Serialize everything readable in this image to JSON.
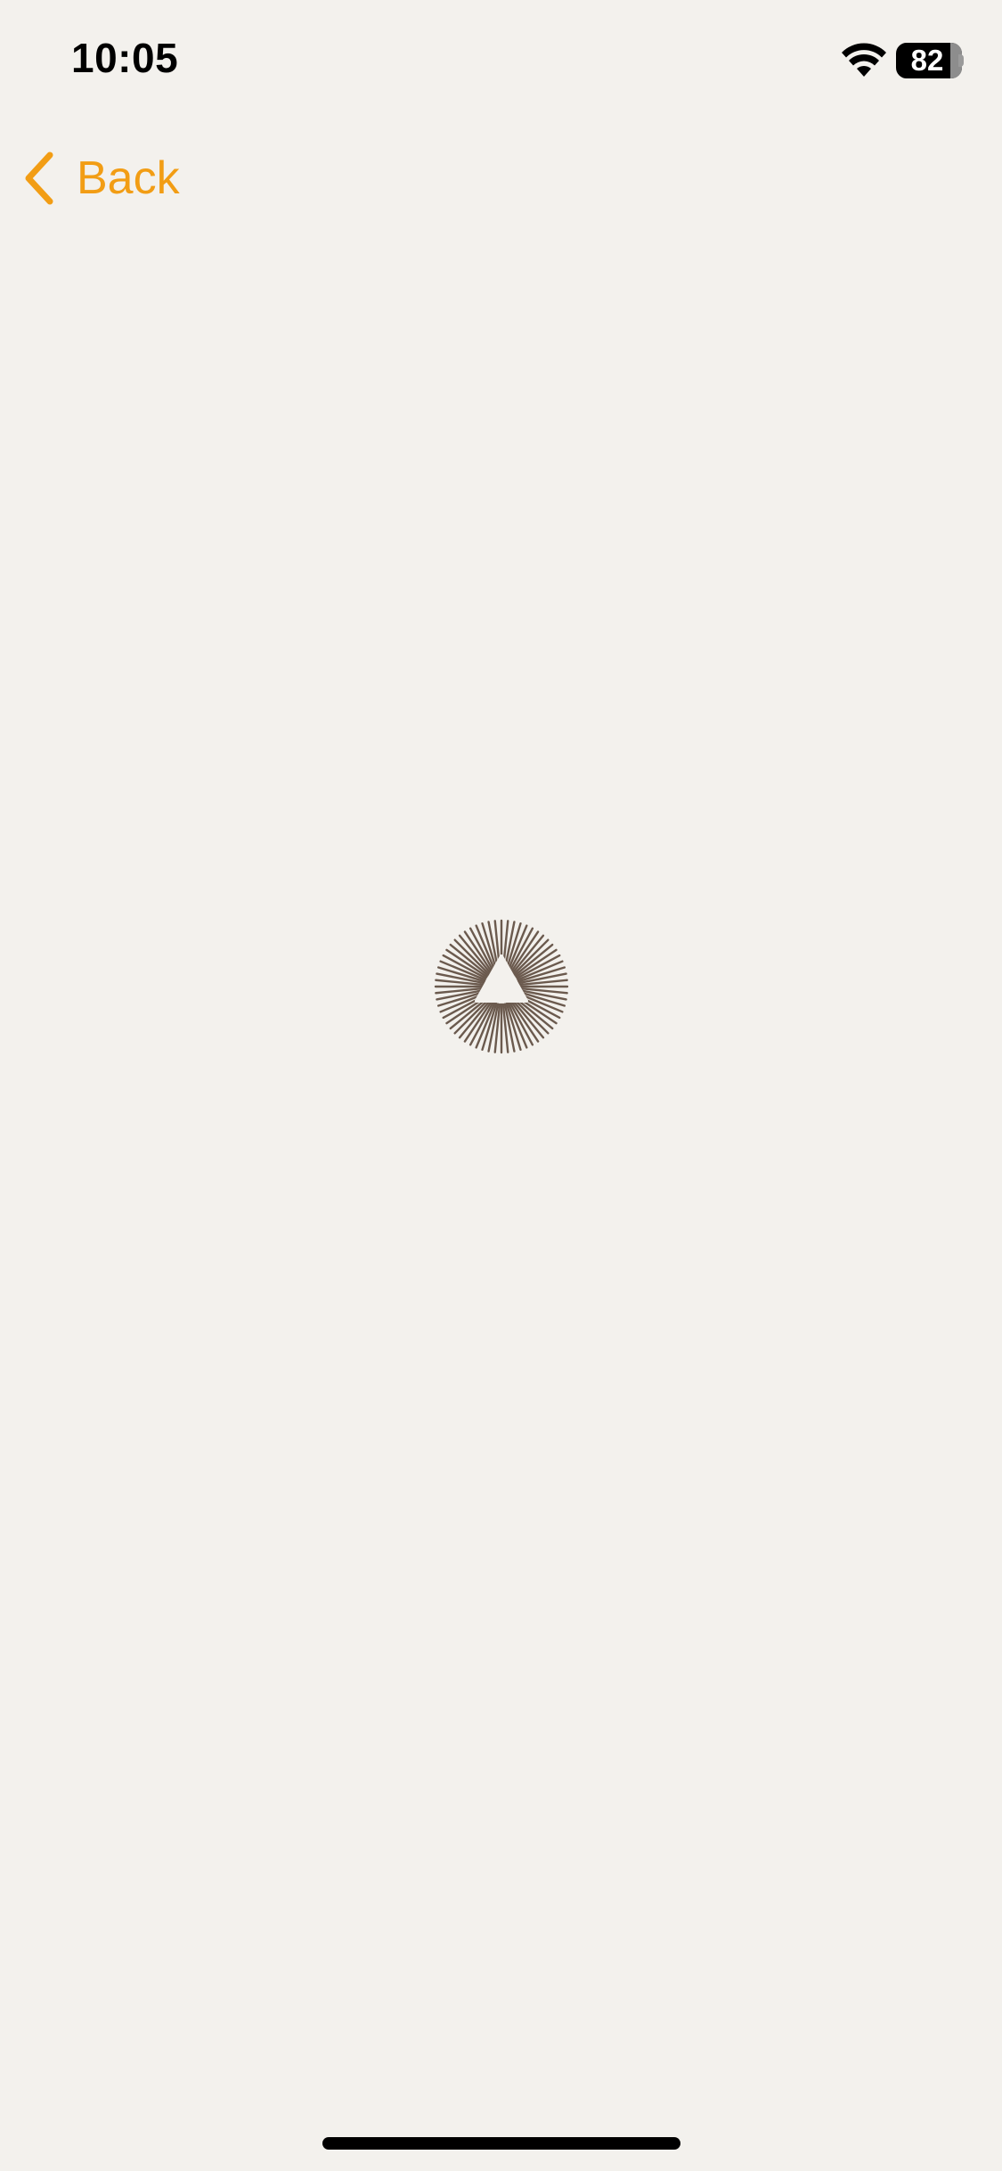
{
  "status_bar": {
    "time": "10:05",
    "battery_level": "82",
    "battery_fraction": 0.82,
    "icons": [
      "wifi-icon",
      "battery-icon"
    ]
  },
  "nav": {
    "back_label": "Back",
    "back_icon": "chevron-left-icon",
    "accent_color": "#f29d14"
  },
  "main": {
    "loader_icon": "sunburst-triangle-loader-icon",
    "loader_color": "#6b5a4e",
    "background_color": "#f3f1ed"
  }
}
